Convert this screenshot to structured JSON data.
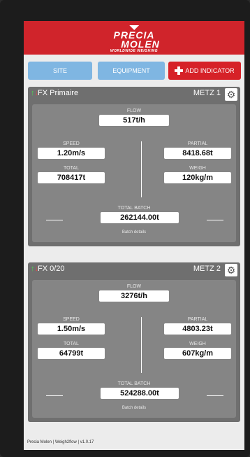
{
  "brand": {
    "line1": "PRECIA",
    "line2": "MOLEN",
    "tagline": "WORLDWIDE WEIGHING"
  },
  "buttons": {
    "site": "SITE",
    "equipment": "EQUIPMENT",
    "add": "ADD INDICATOR"
  },
  "colors": {
    "header": "#d0242b",
    "button_blue": "#7fb6e2",
    "button_red": "#d62128",
    "card": "#6f6f6f"
  },
  "cards": [
    {
      "name": "FX Primaire",
      "location": "METZ 1",
      "flow_label": "FLOW",
      "flow": "517t/h",
      "speed_label": "SPEED",
      "speed": "1.20m/s",
      "partial_label": "PARTIAL",
      "partial": "8418.68t",
      "total_label": "TOTAL",
      "total": "708417t",
      "weigh_label": "WEIGH",
      "weigh": "120kg/m",
      "batch_label": "TOTAL BATCH",
      "batch": "262144.00t",
      "details": "Batch details"
    },
    {
      "name": "FX 0/20",
      "location": "METZ 2",
      "flow_label": "FLOW",
      "flow": "3276t/h",
      "speed_label": "SPEED",
      "speed": "1.50m/s",
      "partial_label": "PARTIAL",
      "partial": "4803.23t",
      "total_label": "TOTAL",
      "total": "64799t",
      "weigh_label": "WEIGH",
      "weigh": "607kg/m",
      "batch_label": "TOTAL BATCH",
      "batch": "524288.00t",
      "details": "Batch details"
    }
  ],
  "footer": "Precia Molen | Weigh2flow | v1.0.17"
}
